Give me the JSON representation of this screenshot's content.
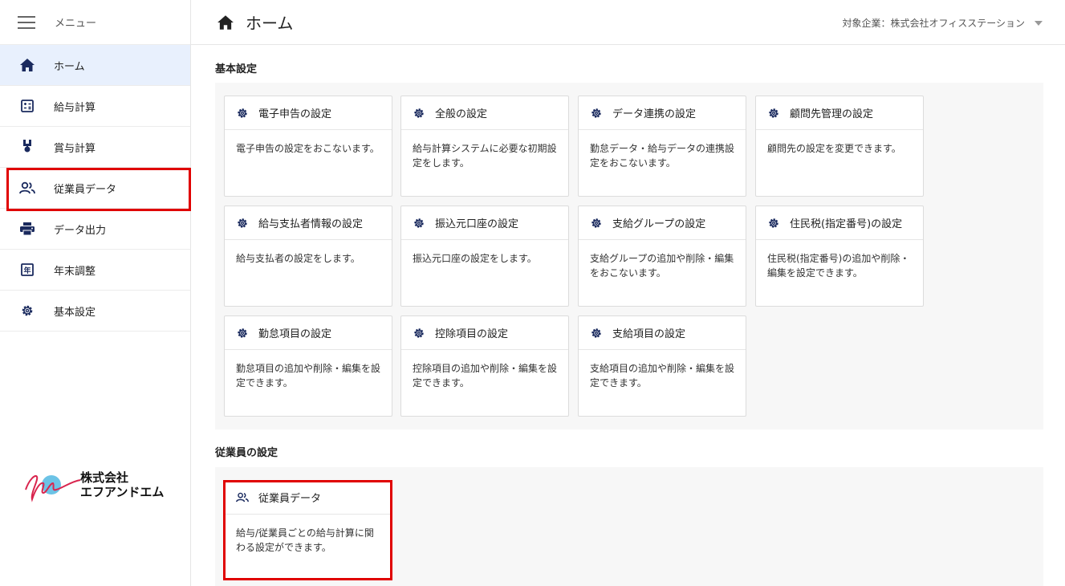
{
  "sidebar": {
    "menu_label": "メニュー",
    "items": [
      {
        "label": "ホーム",
        "icon": "home-icon"
      },
      {
        "label": "給与計算",
        "icon": "calculator-icon"
      },
      {
        "label": "賞与計算",
        "icon": "bonus-icon"
      },
      {
        "label": "従業員データ",
        "icon": "people-icon"
      },
      {
        "label": "データ出力",
        "icon": "printer-icon"
      },
      {
        "label": "年末調整",
        "icon": "year-end-icon"
      },
      {
        "label": "基本設定",
        "icon": "gear-icon"
      }
    ],
    "logo_line1": "株式会社",
    "logo_line2": "エフアンドエム"
  },
  "header": {
    "title": "ホーム",
    "company": "対象企業：株式会社オフィスステーション"
  },
  "sections": {
    "basic": {
      "title": "基本設定",
      "cards": [
        {
          "title": "電子申告の設定",
          "desc": "電子申告の設定をおこないます。"
        },
        {
          "title": "全般の設定",
          "desc": "給与計算システムに必要な初期設定をします。"
        },
        {
          "title": "データ連携の設定",
          "desc": "勤怠データ・給与データの連携設定をおこないます。"
        },
        {
          "title": "顧問先管理の設定",
          "desc": "顧問先の設定を変更できます。"
        },
        {
          "title": "給与支払者情報の設定",
          "desc": "給与支払者の設定をします。"
        },
        {
          "title": "振込元口座の設定",
          "desc": "振込元口座の設定をします。"
        },
        {
          "title": "支給グループの設定",
          "desc": "支給グループの追加や削除・編集をおこないます。"
        },
        {
          "title": "住民税(指定番号)の設定",
          "desc": "住民税(指定番号)の追加や削除・編集を設定できます。"
        },
        {
          "title": "勤怠項目の設定",
          "desc": "勤怠項目の追加や削除・編集を設定できます。"
        },
        {
          "title": "控除項目の設定",
          "desc": "控除項目の追加や削除・編集を設定できます。"
        },
        {
          "title": "支給項目の設定",
          "desc": "支給項目の追加や削除・編集を設定できます。"
        }
      ]
    },
    "employee": {
      "title": "従業員の設定",
      "cards": [
        {
          "title": "従業員データ",
          "desc": "給与/従業員ごとの給与計算に関わる設定ができます。"
        }
      ]
    }
  },
  "colors": {
    "highlight": "#e00000",
    "active_bg": "#e8f0fd",
    "icon": "#1a2a5e"
  }
}
